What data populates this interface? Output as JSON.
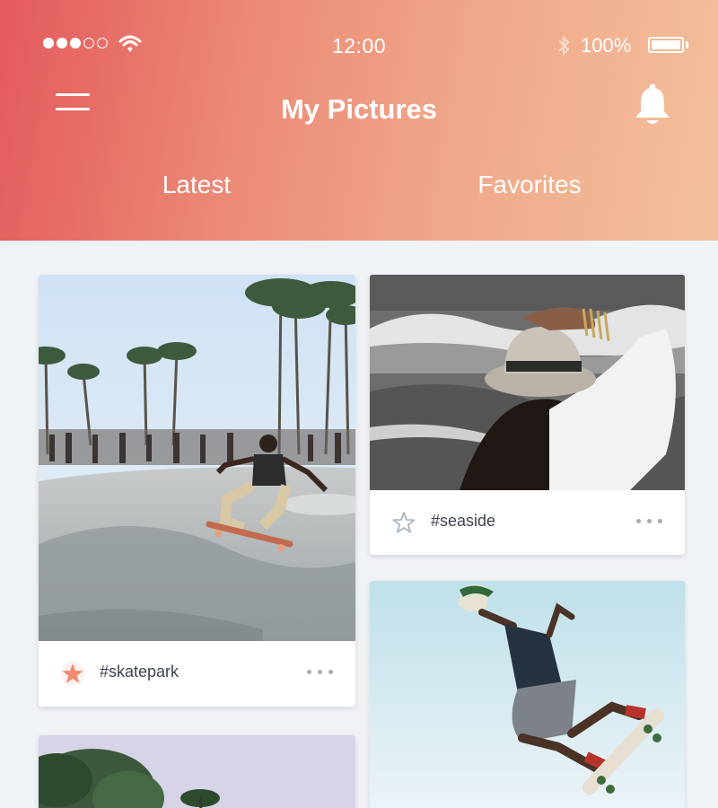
{
  "status_bar": {
    "time": "12:00",
    "battery": "100%",
    "signal_icon": "signal-dots-icon",
    "wifi_icon": "wifi-icon",
    "bluetooth_icon": "bluetooth-icon",
    "battery_icon": "battery-icon"
  },
  "header": {
    "title": "My Pictures",
    "menu_icon": "hamburger-menu-icon",
    "bell_icon": "bell-icon",
    "tabs": [
      {
        "label": "Latest"
      },
      {
        "label": "Favorites"
      }
    ]
  },
  "cards": [
    {
      "tag": "#skatepark",
      "favorited": true,
      "star_icon": "star-filled-icon",
      "more_icon": "more-dots-icon"
    },
    {
      "tag": "#seaside",
      "favorited": false,
      "star_icon": "star-outline-icon",
      "more_icon": "more-dots-icon"
    }
  ],
  "colors": {
    "header_gradient_start": "#e35a5b",
    "header_gradient_end": "#f3c09c",
    "star_active": "#ef8a72",
    "star_inactive": "#a9b6c8",
    "background": "#f0f3f6"
  }
}
